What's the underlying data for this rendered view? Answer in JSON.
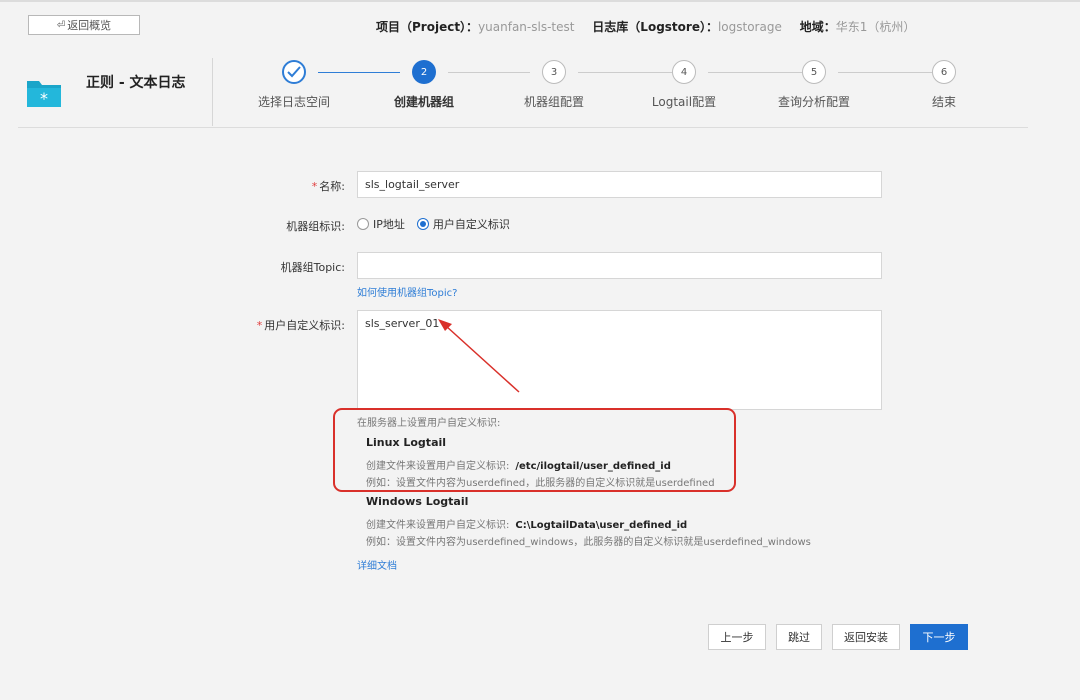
{
  "back_button": "返回概览",
  "meta": {
    "project_key": "项目（Project）：",
    "project_value": "yuanfan-sls-test",
    "logstore_key": "日志库（Logstore）：",
    "logstore_value": "logstorage",
    "region_key": "地域：",
    "region_value": "华东1（杭州）"
  },
  "page_title": "正则 - 文本日志",
  "steps": [
    {
      "num": "✓",
      "label": "选择日志空间",
      "state": "done"
    },
    {
      "num": "2",
      "label": "创建机器组",
      "state": "active"
    },
    {
      "num": "3",
      "label": "机器组配置",
      "state": "todo"
    },
    {
      "num": "4",
      "label": "Logtail配置",
      "state": "todo"
    },
    {
      "num": "5",
      "label": "查询分析配置",
      "state": "todo"
    },
    {
      "num": "6",
      "label": "结束",
      "state": "todo"
    }
  ],
  "form": {
    "name_label": "名称:",
    "name_value": "sls_logtail_server",
    "id_label": "机器组标识:",
    "id_options": [
      "IP地址",
      "用户自定义标识"
    ],
    "id_selected": "用户自定义标识",
    "topic_label": "机器组Topic:",
    "topic_value": "",
    "topic_link": "如何使用机器组Topic?",
    "custom_label": "用户自定义标识:",
    "custom_value": "sls_server_01"
  },
  "help": {
    "intro": "在服务器上设置用户自定义标识:",
    "linux_title": "Linux Logtail",
    "linux_create": "创建文件来设置用户自定义标识:",
    "linux_path": "/etc/ilogtail/user_defined_id",
    "linux_example": "例如：设置文件内容为userdefined，此服务器的自定义标识就是userdefined",
    "windows_title": "Windows Logtail",
    "windows_create": "创建文件来设置用户自定义标识:",
    "windows_path": "C:\\LogtailData\\user_defined_id",
    "windows_example": "例如：设置文件内容为userdefined_windows，此服务器的自定义标识就是userdefined_windows",
    "doc_link": "详细文档"
  },
  "buttons": {
    "prev": "上一步",
    "skip": "跳过",
    "back_install": "返回安装",
    "next": "下一步"
  },
  "colors": {
    "accent": "#1e6fd0",
    "annotation": "#d9302a"
  }
}
